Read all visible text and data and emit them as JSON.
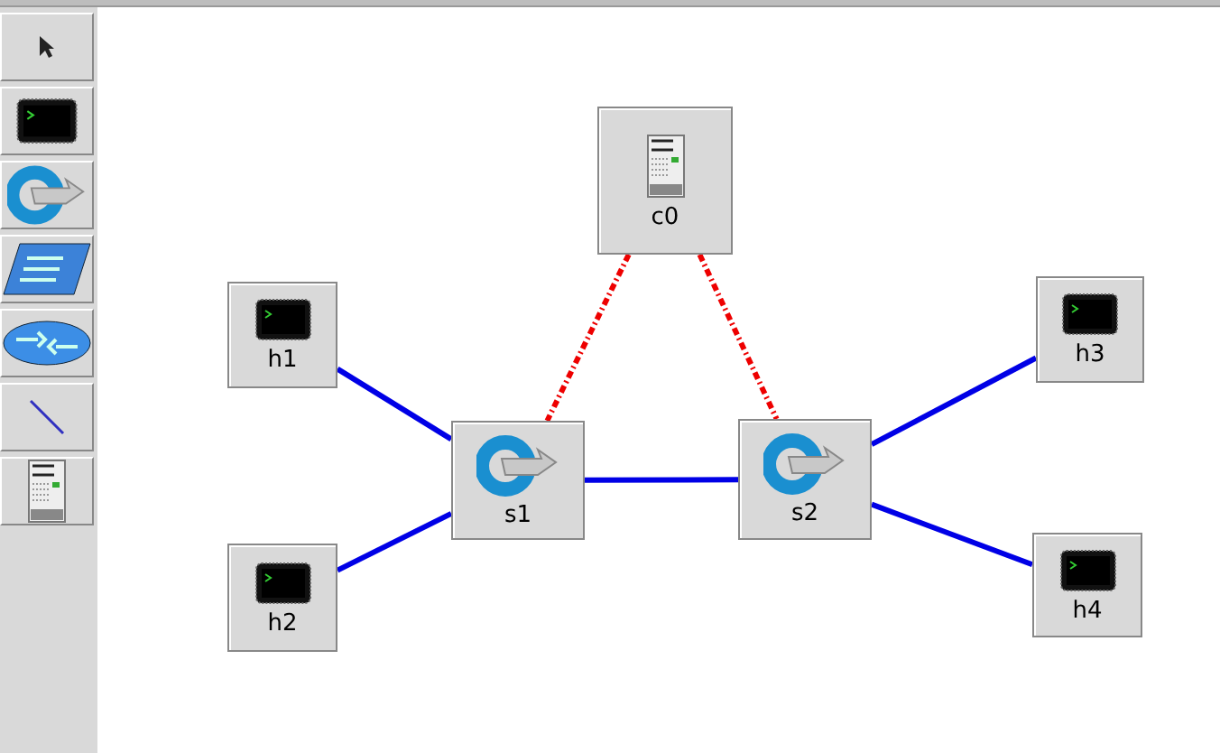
{
  "toolbar": [
    {
      "kind": "select"
    },
    {
      "kind": "host"
    },
    {
      "kind": "switch"
    },
    {
      "kind": "legacy_switch"
    },
    {
      "kind": "legacy_router"
    },
    {
      "kind": "link"
    },
    {
      "kind": "controller"
    }
  ],
  "nodes": [
    {
      "kind": "controller",
      "label": "c0"
    },
    {
      "kind": "host",
      "label": "h1"
    },
    {
      "kind": "host",
      "label": "h2"
    },
    {
      "kind": "switch",
      "label": "s1"
    },
    {
      "kind": "switch",
      "label": "s2"
    },
    {
      "kind": "host",
      "label": "h3"
    },
    {
      "kind": "host",
      "label": "h4"
    }
  ],
  "links": [
    {
      "kind": "data"
    },
    {
      "kind": "data"
    },
    {
      "kind": "data"
    },
    {
      "kind": "data"
    },
    {
      "kind": "data"
    },
    {
      "kind": "control"
    },
    {
      "kind": "control"
    }
  ]
}
